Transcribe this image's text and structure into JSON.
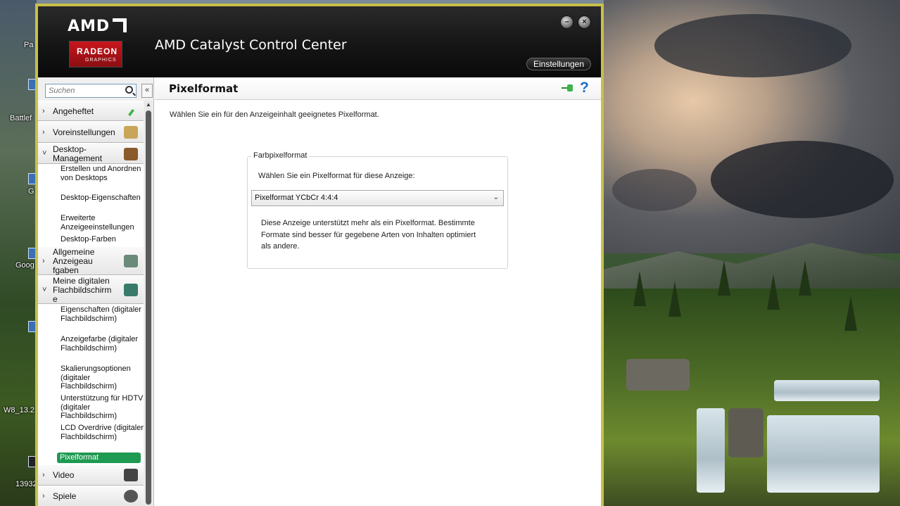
{
  "desktop": {
    "icons": [
      {
        "label": "Pa"
      },
      {
        "label": "Battlef"
      },
      {
        "label": "G"
      },
      {
        "label": "Goog"
      },
      {
        "label": "W8_13.2"
      },
      {
        "label": "13932"
      }
    ]
  },
  "window": {
    "title": "AMD Catalyst Control Center",
    "logo": {
      "brand": "AMD",
      "product": "RADEON",
      "sub": "GRAPHICS"
    },
    "settings_label": "Einstellungen",
    "minimize_glyph": "–",
    "close_glyph": "×"
  },
  "sidebar": {
    "search_placeholder": "Suchen",
    "collapse_glyph": "«",
    "items": [
      {
        "type": "cat",
        "label": "Angeheftet",
        "expanded": false,
        "icon": "pin-icon"
      },
      {
        "type": "cat",
        "label": "Voreinstellungen",
        "expanded": false,
        "icon": "presets-icon"
      },
      {
        "type": "cat",
        "label": "Desktop-Management",
        "expanded": true,
        "icon": "desktop-management-icon",
        "children": [
          "Erstellen und Anordnen von Desktops",
          "Desktop-Eigenschaften",
          "Erweiterte Anzeigeeinstellungen",
          "Desktop-Farben"
        ]
      },
      {
        "type": "cat",
        "label": "Allgemeine Anzeigeaufgaben",
        "expanded": false,
        "icon": "display-tasks-icon"
      },
      {
        "type": "cat",
        "label": "Meine digitalen Flachbildschirme",
        "expanded": true,
        "icon": "flatpanel-icon",
        "children": [
          "Eigenschaften (digitaler Flachbildschirm)",
          "Anzeigefarbe (digitaler Flachbildschirm)",
          "Skalierungsoptionen (digitaler Flachbildschirm)",
          "Unterstützung für HDTV (digitaler Flachbildschirm)",
          "LCD Overdrive (digitaler Flachbildschirm)",
          "Pixelformat"
        ],
        "active_child": "Pixelformat"
      },
      {
        "type": "cat",
        "label": "Video",
        "expanded": false,
        "icon": "video-icon"
      },
      {
        "type": "cat",
        "label": "Spiele",
        "expanded": false,
        "icon": "games-icon"
      }
    ]
  },
  "main": {
    "title": "Pixelformat",
    "intro": "Wählen Sie ein für den Anzeigeinhalt geeignetes Pixelformat.",
    "group": {
      "label": "Farbpixelformat",
      "select_label": "Wählen Sie ein Pixelformat für diese Anzeige:",
      "selected_value": "Pixelformat YCbCr 4:4:4",
      "description": "Diese Anzeige unterstützt mehr als ein Pixelformat. Bestimmte Formate sind besser für gegebene Arten von Inhalten optimiert als andere."
    },
    "help_glyph": "?"
  },
  "colors": {
    "accent_green": "#1e9a52",
    "header_dark": "#151515",
    "window_border": "#c8c04a",
    "help_blue": "#1a6fc4"
  }
}
